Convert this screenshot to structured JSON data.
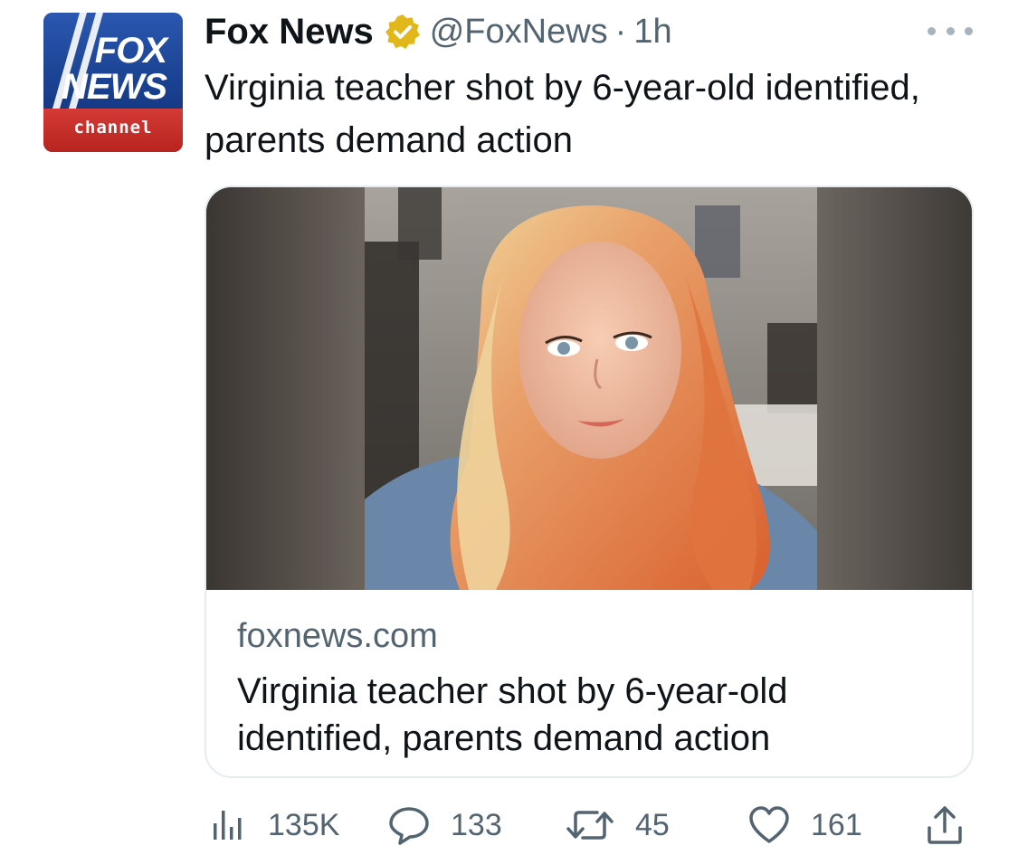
{
  "author": {
    "name": "Fox News",
    "handle": "@FoxNews",
    "separator": "·",
    "time": "1h",
    "avatar_logo_line1": "FOX",
    "avatar_logo_line2": "NEWS",
    "avatar_logo_line3": "channel",
    "verified_color": "#e2b719"
  },
  "tweet": {
    "text": "Virginia teacher shot by 6-year-old identified, parents demand action"
  },
  "card": {
    "domain": "foxnews.com",
    "title": "Virginia teacher shot by 6-year-old identified, parents demand action"
  },
  "metrics": {
    "views": "135K",
    "replies": "133",
    "retweets": "45",
    "likes": "161"
  },
  "icons": [
    "more-icon",
    "verified-icon",
    "views-icon",
    "reply-icon",
    "retweet-icon",
    "like-icon",
    "share-icon"
  ]
}
